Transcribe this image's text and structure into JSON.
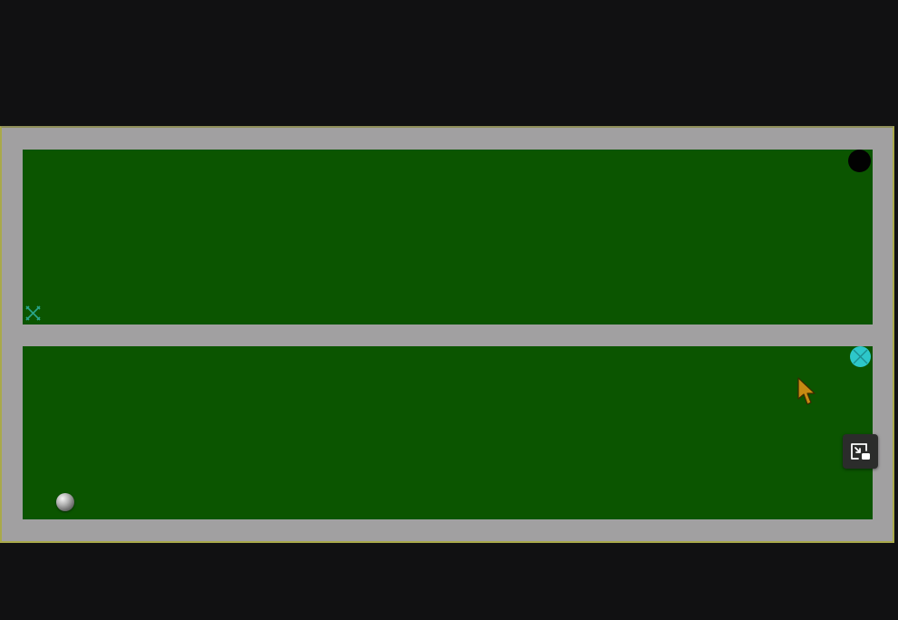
{
  "game": {
    "screen_background": "#111112",
    "wall_color": "#a1a0a1",
    "field_color": "#0b5500",
    "hole_color": "#020202",
    "start_marker_color": "#2aa58b",
    "target_marker_color": "#2dc7ca",
    "cursor_color": "#c68a12"
  },
  "icons": {
    "ball": "ball-icon",
    "hole": "hole-icon",
    "start_marker": "x-marker-icon",
    "target_marker": "crosshair-circle-icon",
    "cursor": "mouse-pointer-icon",
    "pip_button": "picture-in-picture-exit-icon"
  }
}
